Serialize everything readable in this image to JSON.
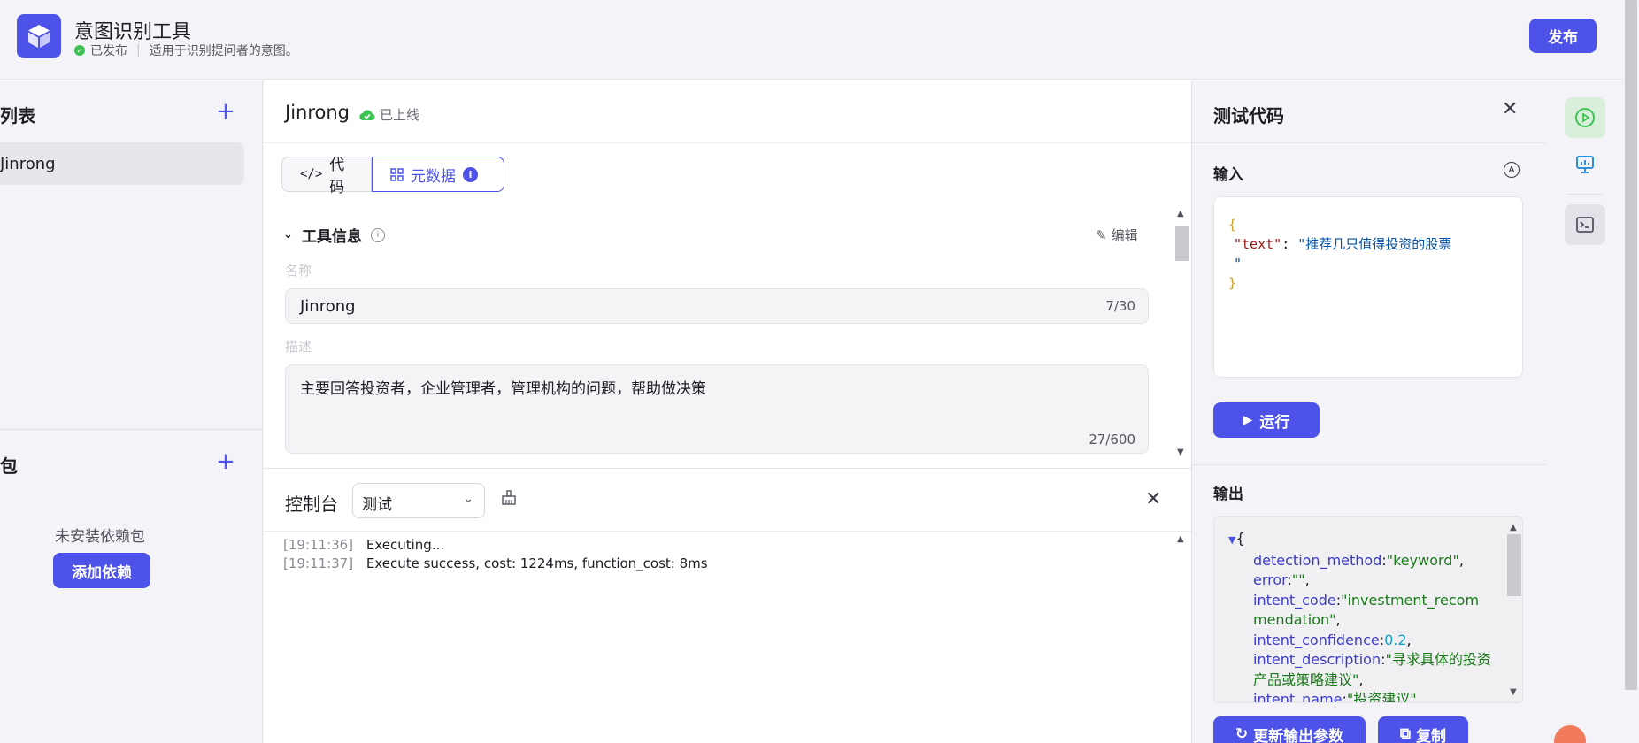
{
  "header": {
    "app_title": "意图识别工具",
    "status": "已发布",
    "description": "适用于识别提问者的意图。",
    "publish_label": "发布"
  },
  "sidebar": {
    "list_title": "列表",
    "items": [
      {
        "label": "Jinrong"
      }
    ],
    "packages_title": "包",
    "no_deps_text": "未安装依赖包",
    "add_dep_label": "添加依赖"
  },
  "tool": {
    "name": "Jinrong",
    "online_status": "已上线",
    "tabs": [
      {
        "label": "代码"
      },
      {
        "label": "元数据"
      }
    ],
    "section_title": "工具信息",
    "edit_label": "编辑",
    "name_label": "名称",
    "name_value": "Jinrong",
    "name_counter": "7/30",
    "desc_label": "描述",
    "desc_value": "主要回答投资者，企业管理者，管理机构的问题，帮助做决策",
    "desc_counter": "27/600"
  },
  "console": {
    "title": "控制台",
    "select_value": "测试",
    "logs": [
      {
        "time": "[19:11:36]",
        "message": "Executing..."
      },
      {
        "time": "[19:11:37]",
        "message": "Execute success, cost: 1224ms, function_cost: 8ms"
      }
    ]
  },
  "test_panel": {
    "title": "测试代码",
    "input_label": "输入",
    "input_json": {
      "open": "{",
      "key": "\"text\"",
      "colon": ": ",
      "value": "\"推荐几只值得投资的股票",
      "value_end": "\"",
      "close": "}"
    },
    "run_label": "运行",
    "output_label": "输出",
    "output": {
      "open": "{",
      "fields": [
        {
          "key": "detection_method",
          "value": "\"keyword\"",
          "type": "string"
        },
        {
          "key": "error",
          "value": "\"\"",
          "type": "string"
        },
        {
          "key": "intent_code",
          "value": "\"investment_recommendation\"",
          "type": "string"
        },
        {
          "key": "intent_confidence",
          "value": "0.2",
          "type": "number"
        },
        {
          "key": "intent_description",
          "value": "\"寻求具体的投资产品或策略建议\"",
          "type": "string"
        },
        {
          "key": "intent_name",
          "value": "\"投资建议\"",
          "type": "string"
        }
      ]
    },
    "update_params_label": "更新输出参数",
    "copy_label": "复制"
  },
  "colors": {
    "accent": "#4d53e8",
    "success": "#3ec254",
    "background": "#f4f4f8"
  }
}
